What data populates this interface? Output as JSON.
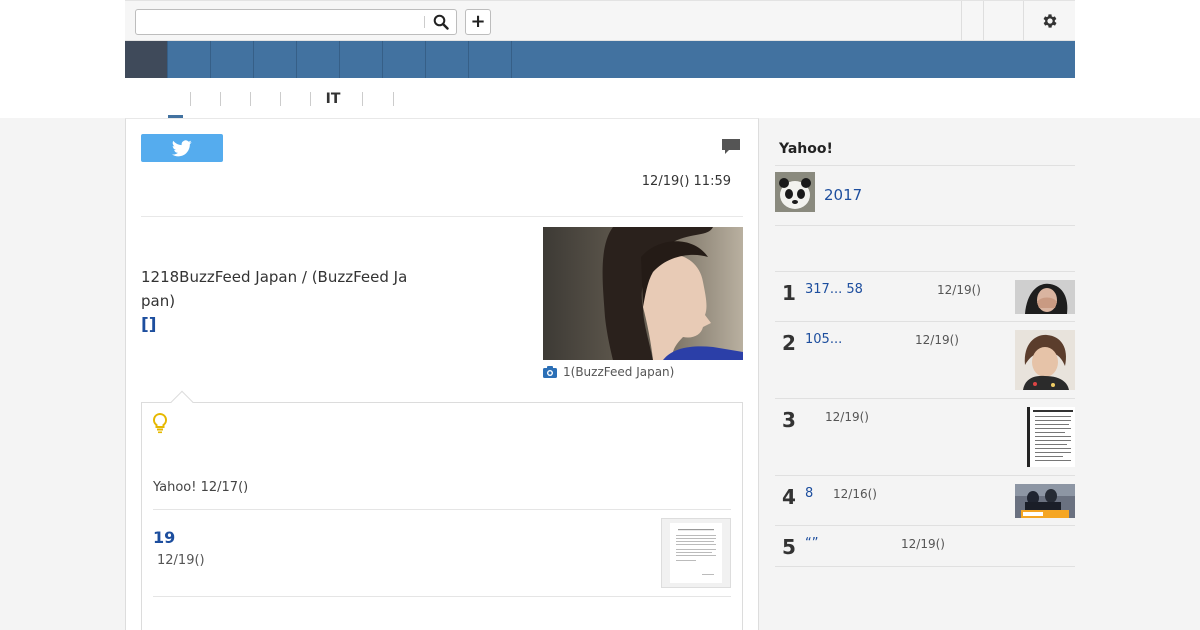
{
  "header": {
    "search_placeholder": "",
    "add_label": "+"
  },
  "subtabs": [
    {
      "label": ""
    },
    {
      "label": ""
    },
    {
      "label": ""
    },
    {
      "label": ""
    },
    {
      "label": ""
    },
    {
      "label": "IT"
    },
    {
      "label": ""
    },
    {
      "label": ""
    }
  ],
  "article": {
    "published": "12/19() 11:59",
    "body": "1218BuzzFeed Japan / (BuzzFeed Japan)",
    "link": "[]",
    "photo_caption": "1(BuzzFeed Japan)"
  },
  "related": {
    "source": "Yahoo! 12/17()",
    "item_title": "19",
    "item_date": "12/19()"
  },
  "sidebar": {
    "title": "Yahoo!",
    "feature_text": "2017",
    "rankings": [
      {
        "rank": "1",
        "text": "317... 58",
        "date": "12/19()"
      },
      {
        "rank": "2",
        "text": "105...",
        "date": "12/19()"
      },
      {
        "rank": "3",
        "text": "",
        "date": "12/19()"
      },
      {
        "rank": "4",
        "text": "8",
        "date": "12/16()"
      },
      {
        "rank": "5",
        "text": "“”",
        "date": "12/19()"
      }
    ]
  },
  "colors": {
    "nav": "#4272a0",
    "nav_active": "#3f4a5a",
    "link": "#1d4e9e",
    "twitter": "#55acee"
  }
}
